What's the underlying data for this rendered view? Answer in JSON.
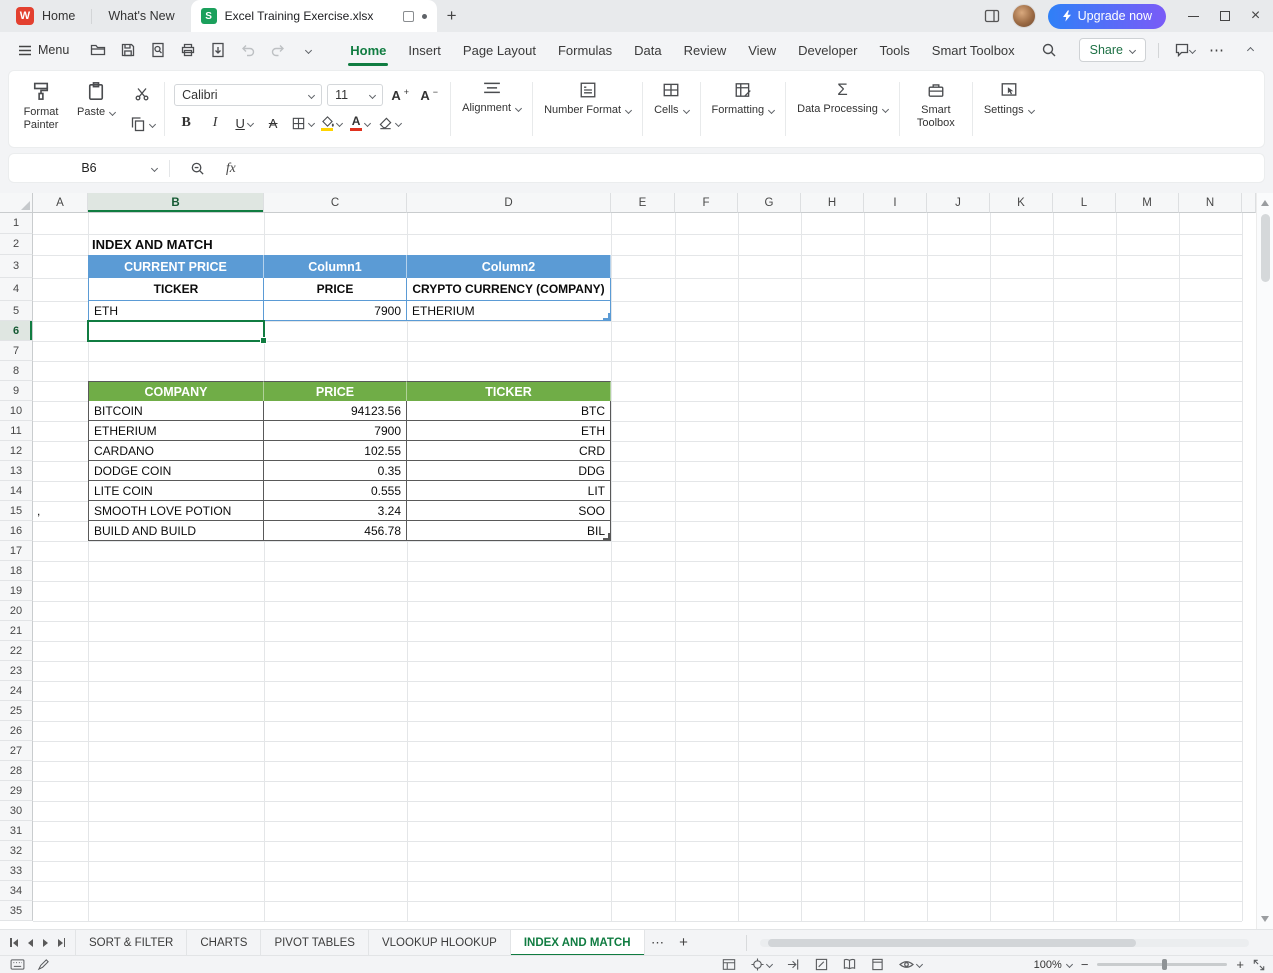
{
  "titlebar": {
    "home_tab": "Home",
    "whats_new_tab": "What's New",
    "doc_tab": "Excel Training Exercise.xlsx",
    "upgrade": "Upgrade now",
    "wps_logo_letter": "W",
    "sheet_icon_letter": "S"
  },
  "menubar": {
    "menu": "Menu",
    "tabs": [
      "Home",
      "Insert",
      "Page Layout",
      "Formulas",
      "Data",
      "Review",
      "View",
      "Developer",
      "Tools",
      "Smart Toolbox"
    ],
    "active_tab": "Home",
    "share": "Share"
  },
  "ribbon": {
    "format_painter": "Format Painter",
    "paste": "Paste",
    "font_name": "Calibri",
    "font_size": "11",
    "bold": "B",
    "italic": "I",
    "underline": "U",
    "alignment": "Alignment",
    "number_format": "Number Format",
    "cells": "Cells",
    "formatting": "Formatting",
    "data_processing": "Data Processing",
    "smart_toolbox": "Smart Toolbox",
    "settings": "Settings"
  },
  "formula_bar": {
    "name_box": "B6",
    "fx_label": "fx",
    "formula": ""
  },
  "grid": {
    "columns": [
      "A",
      "B",
      "C",
      "D",
      "E",
      "F",
      "G",
      "H",
      "I",
      "J",
      "K",
      "L",
      "M",
      "N"
    ],
    "row_count": 35,
    "selected_cell": "B6",
    "selected_column": "B",
    "selected_row": 6
  },
  "cells": {
    "title": {
      "ref": "B2",
      "text": "INDEX AND MATCH"
    },
    "a15": ",",
    "top_table": {
      "header": [
        "CURRENT PRICE",
        "Column1",
        "Column2"
      ],
      "subheader": [
        "TICKER",
        "PRICE",
        "CRYPTO CURRENCY (COMPANY)"
      ],
      "data_row": [
        "ETH",
        "7900",
        "ETHERIUM"
      ]
    },
    "bottom_table": {
      "header": [
        "COMPANY",
        "PRICE",
        "TICKER"
      ],
      "rows": [
        [
          "BITCOIN",
          "94123.56",
          "BTC"
        ],
        [
          "ETHERIUM",
          "7900",
          "ETH"
        ],
        [
          "CARDANO",
          "102.55",
          "CRD"
        ],
        [
          "DODGE COIN",
          "0.35",
          "DDG"
        ],
        [
          "LITE COIN",
          "0.555",
          "LIT"
        ],
        [
          "SMOOTH LOVE POTION",
          "3.24",
          "SOO"
        ],
        [
          "BUILD AND BUILD",
          "456.78",
          "BIL"
        ]
      ]
    }
  },
  "sheet_tabs": {
    "items": [
      "SORT & FILTER",
      "CHARTS",
      "PIVOT TABLES",
      "VLOOKUP HLOOKUP",
      "INDEX AND MATCH"
    ],
    "active": "INDEX AND MATCH",
    "more": "⋯",
    "add": "+"
  },
  "status_bar": {
    "zoom": "100%",
    "zoom_out": "−",
    "zoom_in": "+"
  },
  "colors": {
    "blue_header": "#5B9BD5",
    "green_header": "#70AD47",
    "accent_green": "#107C41",
    "upgrade_from": "#2F80F7",
    "upgrade_to": "#7A5BF7",
    "logo_red": "#E3402F",
    "sheet_icon_green": "#1BA05C",
    "fill_swatch": "#FFD400",
    "font_swatch": "#E0321F",
    "dark_table_border": "#595959"
  },
  "glyphs": {
    "plus": "+",
    "minus": "−",
    "close": "×",
    "more": "⋯",
    "sigma": "Σ",
    "letter_a": "A"
  }
}
